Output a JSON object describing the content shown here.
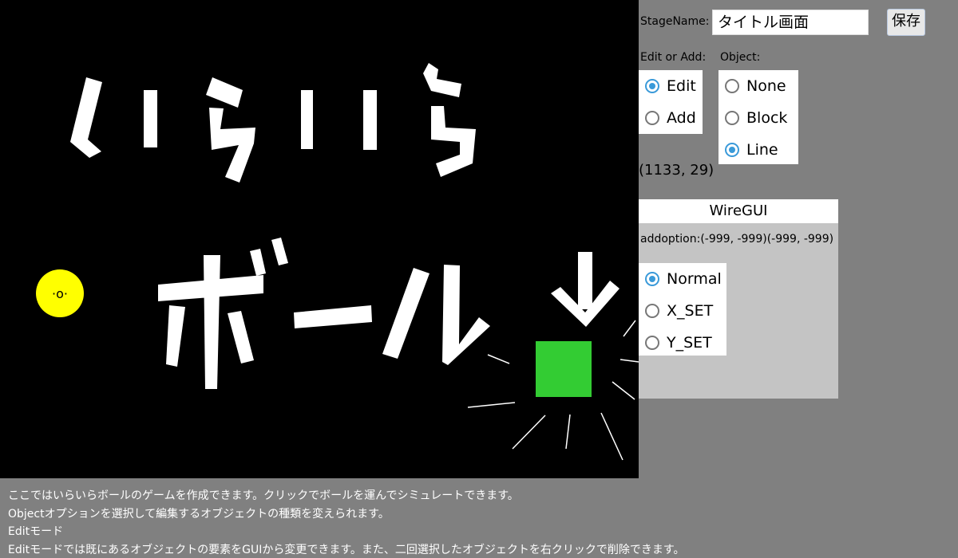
{
  "stage": {
    "title_line1": "いらいら",
    "title_line2": "ボール",
    "arrow": "↓",
    "ball_face": "·o·",
    "ball_color": "#ffff00",
    "goal_color": "#33cc33",
    "background_color": "#000000"
  },
  "panel": {
    "stage_name_label": "StageName:",
    "stage_name_value": "タイトル画面",
    "save_button": "保存",
    "edit_or_add_label": "Edit or Add:",
    "object_label": "Object:",
    "mode_options": [
      {
        "label": "Edit",
        "selected": true
      },
      {
        "label": "Add",
        "selected": false
      }
    ],
    "object_options": [
      {
        "label": "None",
        "selected": false
      },
      {
        "label": "Block",
        "selected": false
      },
      {
        "label": "Line",
        "selected": true
      }
    ],
    "cursor_readout": "(1133, 29)",
    "radio_accent_color": "#3a9ad9"
  },
  "wire_gui": {
    "title": "WireGUI",
    "addoption": "addoption:(-999, -999)(-999, -999)",
    "options": [
      {
        "label": "Normal",
        "selected": true
      },
      {
        "label": "X_SET",
        "selected": false
      },
      {
        "label": "Y_SET",
        "selected": false
      }
    ]
  },
  "description": {
    "lines": [
      "ここではいらいらボールのゲームを作成できます。クリックでボールを運んでシミュレートできます。",
      "Objectオプションを選択して編集するオブジェクトの種類を変えられます。",
      "Editモード",
      "Editモードでは既にあるオブジェクトの要素をGUIから変更できます。また、二回選択したオブジェクトを右クリックで削除できます。"
    ]
  }
}
